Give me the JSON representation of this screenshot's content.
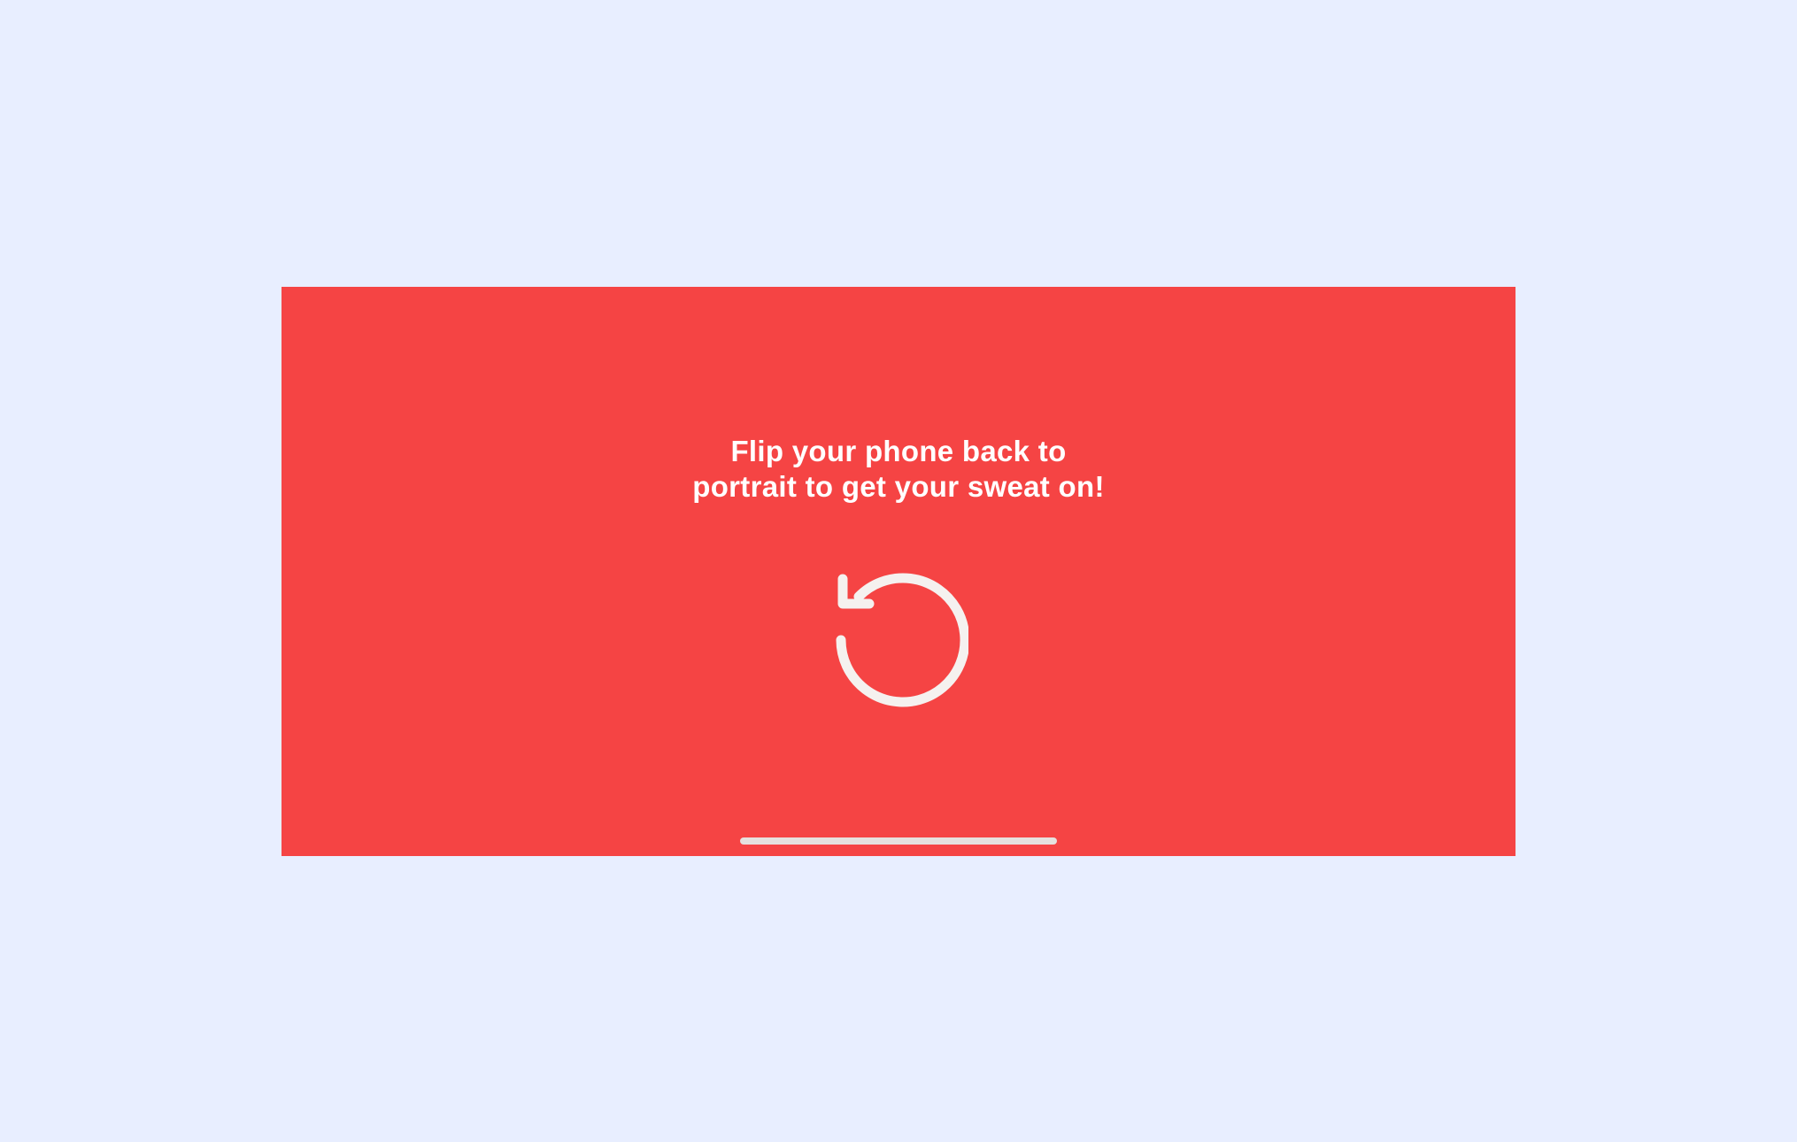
{
  "screen": {
    "background_color": "#f54444",
    "page_background_color": "#e8eeff",
    "message_lines": [
      "Flip your phone back to",
      "portrait to get your sweat on!"
    ],
    "icon": "rotate-counterclockwise-icon",
    "icon_color": "#f5f1ef"
  }
}
